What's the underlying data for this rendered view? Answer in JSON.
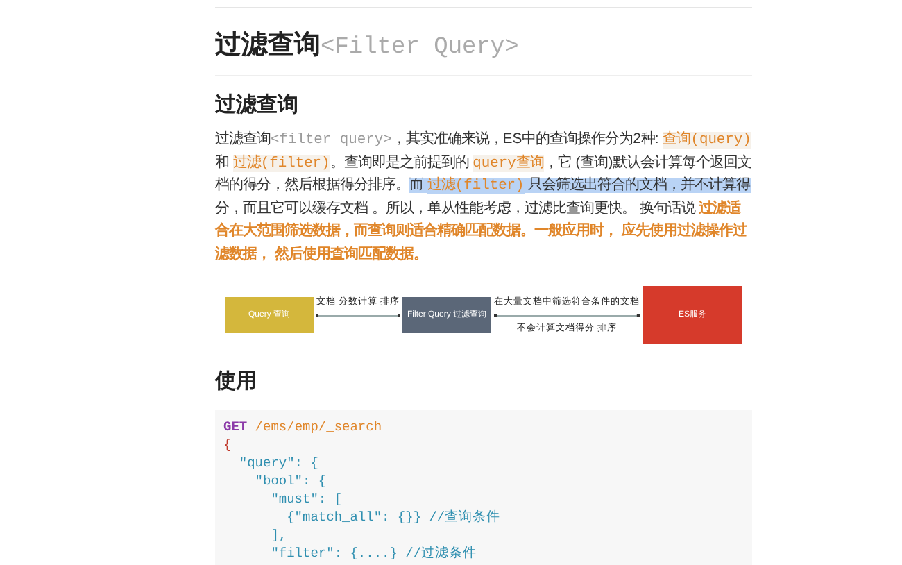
{
  "title": {
    "text": "过滤查询",
    "code": "<Filter Query>"
  },
  "section_heading": "过滤查询",
  "paragraph": [
    {
      "kind": "plain",
      "text": "过滤查询",
      "highlighted": false
    },
    {
      "kind": "code",
      "text": "<filter query>",
      "highlighted": false
    },
    {
      "kind": "plain",
      "text": "，其实准确来说，ES中的查询操作分为2种: ",
      "highlighted": false
    },
    {
      "kind": "accent-code",
      "text": "查询(query)",
      "highlighted": false
    },
    {
      "kind": "plain",
      "text": " 和 ",
      "highlighted": false
    },
    {
      "kind": "accent-code",
      "text": "过滤(filter)",
      "highlighted": false
    },
    {
      "kind": "plain",
      "text": "。查询即是之前提到的 ",
      "highlighted": false
    },
    {
      "kind": "accent-code",
      "text": "query查询",
      "highlighted": false
    },
    {
      "kind": "plain",
      "text": "，它 (查询)默认会计算每个返回文档的得分，然后根据得分排序。",
      "highlighted": false
    },
    {
      "kind": "plain",
      "text": "而 ",
      "highlighted": true
    },
    {
      "kind": "accent-code",
      "text": "过滤(filter)",
      "highlighted": true
    },
    {
      "kind": "plain",
      "text": " 只会筛选出符合的文档，并不计算得",
      "highlighted": true
    },
    {
      "kind": "plain",
      "text": "分，而且它可以缓存文档 。所以，单从性能考虑，过滤比查询更快。 换句话说 ",
      "highlighted": false
    },
    {
      "kind": "accent-bold",
      "text": "过滤适合在大范围筛选数据，而查询则适合精确匹配数据。一般应用时， 应先使用过滤操作过滤数据， 然后使用查询匹配数据。",
      "highlighted": false
    }
  ],
  "diagram": {
    "nodes": [
      {
        "label": "Query 查询",
        "color": "#d4b73c"
      },
      {
        "label": "Filter Query 过滤查询",
        "color": "#5b6778"
      },
      {
        "label": "ES服务",
        "color": "#d63a2b"
      }
    ],
    "edges": [
      {
        "above": "文档 分数计算 排序"
      },
      {
        "above": "在大量文档中筛选符合条件的文档",
        "below": "不会计算文档得分 排序"
      }
    ]
  },
  "usage_heading": "使用",
  "code_block": [
    {
      "tokens": [
        {
          "kind": "keyword",
          "text": "GET"
        },
        {
          "kind": "url",
          "text": " /ems/emp/_search"
        }
      ]
    },
    {
      "tokens": [
        {
          "kind": "brace",
          "text": "{"
        }
      ]
    },
    {
      "tokens": [
        {
          "kind": "key",
          "text": "  \"query\": {"
        }
      ]
    },
    {
      "tokens": [
        {
          "kind": "key",
          "text": "    \"bool\": {"
        }
      ]
    },
    {
      "tokens": [
        {
          "kind": "key",
          "text": "      \"must\": ["
        }
      ]
    },
    {
      "tokens": [
        {
          "kind": "key",
          "text": "        {\"match_all\": {}} //查询条件"
        }
      ]
    },
    {
      "tokens": [
        {
          "kind": "key",
          "text": "      ],"
        }
      ]
    },
    {
      "tokens": [
        {
          "kind": "key",
          "text": "      \"filter\": {....} //过滤条件"
        }
      ]
    }
  ]
}
